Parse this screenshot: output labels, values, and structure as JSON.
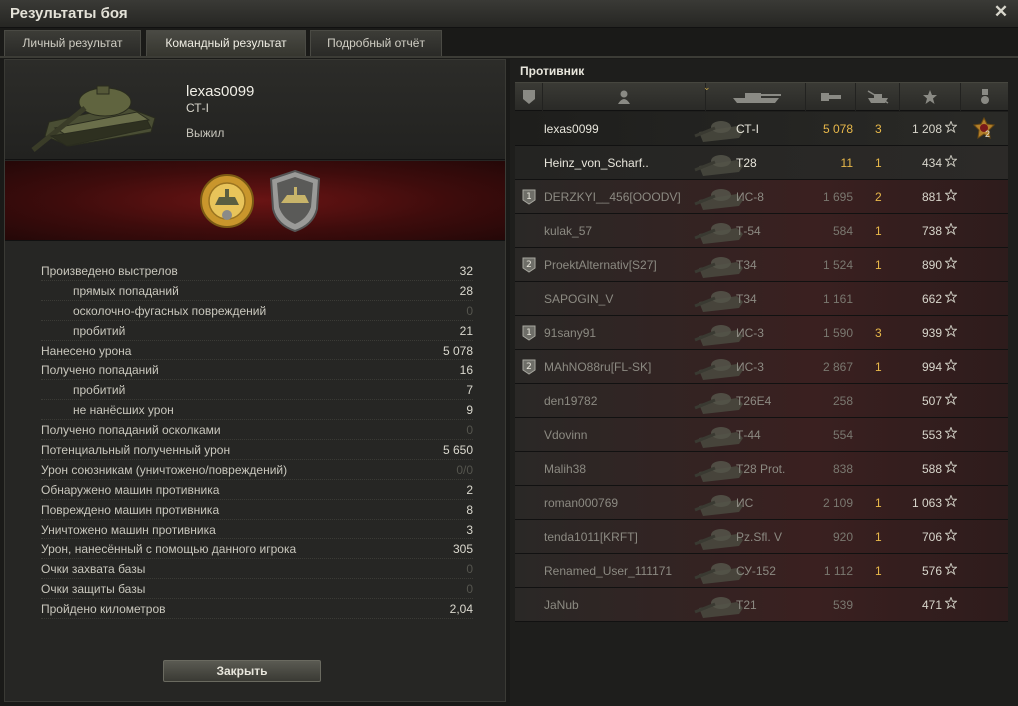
{
  "window": {
    "title": "Результаты боя"
  },
  "tabs": [
    {
      "label": "Личный результат",
      "active": false
    },
    {
      "label": "Командный результат",
      "active": true
    },
    {
      "label": "Подробный отчёт",
      "active": false
    }
  ],
  "player": {
    "name": "lexas0099",
    "tank": "СТ-I",
    "status": "Выжил"
  },
  "stats": [
    {
      "label": "Произведено выстрелов",
      "value": "32",
      "sub": false,
      "dim": false
    },
    {
      "label": "прямых попаданий",
      "value": "28",
      "sub": true,
      "dim": false
    },
    {
      "label": "осколочно-фугасных повреждений",
      "value": "0",
      "sub": true,
      "dim": true
    },
    {
      "label": "пробитий",
      "value": "21",
      "sub": true,
      "dim": false
    },
    {
      "label": "Нанесено урона",
      "value": "5 078",
      "sub": false,
      "dim": false
    },
    {
      "label": "Получено попаданий",
      "value": "16",
      "sub": false,
      "dim": false
    },
    {
      "label": "пробитий",
      "value": "7",
      "sub": true,
      "dim": false
    },
    {
      "label": "не нанёсших урон",
      "value": "9",
      "sub": true,
      "dim": false
    },
    {
      "label": "Получено попаданий осколками",
      "value": "0",
      "sub": false,
      "dim": true
    },
    {
      "label": "Потенциальный полученный урон",
      "value": "5 650",
      "sub": false,
      "dim": false
    },
    {
      "label": "Урон союзникам (уничтожено/повреждений)",
      "value": "0/0",
      "sub": false,
      "dim": true
    },
    {
      "label": "Обнаружено машин противника",
      "value": "2",
      "sub": false,
      "dim": false
    },
    {
      "label": "Повреждено машин противника",
      "value": "8",
      "sub": false,
      "dim": false
    },
    {
      "label": "Уничтожено машин противника",
      "value": "3",
      "sub": false,
      "dim": false
    },
    {
      "label": "Урон, нанесённый с помощью данного игрока",
      "value": "305",
      "sub": false,
      "dim": false
    },
    {
      "label": "Очки захвата базы",
      "value": "0",
      "sub": false,
      "dim": true
    },
    {
      "label": "Очки защиты базы",
      "value": "0",
      "sub": false,
      "dim": true
    },
    {
      "label": "Пройдено километров",
      "value": "2,04",
      "sub": false,
      "dim": false
    }
  ],
  "close_button": "Закрыть",
  "team": {
    "label": "Противник",
    "rows": [
      {
        "name": "lexas0099",
        "vehicle": "СТ-I",
        "damage": "5 078",
        "kills": "3",
        "xp": "1 208",
        "state": "self",
        "tier": "",
        "rank_count": "2"
      },
      {
        "name": "Heinz_von_Scharf..",
        "vehicle": "T28",
        "damage": "11",
        "kills": "1",
        "xp": "434",
        "state": "alive",
        "tier": ""
      },
      {
        "name": "DERZKYI__456[OOODV]",
        "vehicle": "ИС-8",
        "damage": "1 695",
        "kills": "2",
        "xp": "881",
        "state": "dead",
        "tier": "1"
      },
      {
        "name": "kulak_57",
        "vehicle": "Т-54",
        "damage": "584",
        "kills": "1",
        "xp": "738",
        "state": "dead",
        "tier": ""
      },
      {
        "name": "ProektAlternativ[S27]",
        "vehicle": "Т34",
        "damage": "1 524",
        "kills": "1",
        "xp": "890",
        "state": "dead",
        "tier": "2"
      },
      {
        "name": "SAPOGIN_V",
        "vehicle": "Т34",
        "damage": "1 161",
        "kills": "",
        "xp": "662",
        "state": "dead",
        "tier": ""
      },
      {
        "name": "91sany91",
        "vehicle": "ИС-3",
        "damage": "1 590",
        "kills": "3",
        "xp": "939",
        "state": "dead",
        "tier": "1"
      },
      {
        "name": "MAhNO88ru[FL-SK]",
        "vehicle": "ИС-3",
        "damage": "2 867",
        "kills": "1",
        "xp": "994",
        "state": "dead",
        "tier": "2"
      },
      {
        "name": "den19782",
        "vehicle": "T26E4",
        "damage": "258",
        "kills": "",
        "xp": "507",
        "state": "dead",
        "tier": ""
      },
      {
        "name": "Vdovinn",
        "vehicle": "Т-44",
        "damage": "554",
        "kills": "",
        "xp": "553",
        "state": "dead",
        "tier": ""
      },
      {
        "name": "Malih38",
        "vehicle": "T28 Prot.",
        "damage": "838",
        "kills": "",
        "xp": "588",
        "state": "dead",
        "tier": ""
      },
      {
        "name": "roman000769",
        "vehicle": "ИС",
        "damage": "2 109",
        "kills": "1",
        "xp": "1 063",
        "state": "dead",
        "tier": ""
      },
      {
        "name": "tenda1011[KRFT]",
        "vehicle": "Pz.Sfl. V",
        "damage": "920",
        "kills": "1",
        "xp": "706",
        "state": "dead",
        "tier": ""
      },
      {
        "name": "Renamed_User_111171",
        "vehicle": "СУ-152",
        "damage": "1 112",
        "kills": "1",
        "xp": "576",
        "state": "dead",
        "tier": ""
      },
      {
        "name": "JaNub",
        "vehicle": "T21",
        "damage": "539",
        "kills": "",
        "xp": "471",
        "state": "dead",
        "tier": ""
      }
    ]
  },
  "colors": {
    "accent_gold": "#e8b84a",
    "dead_row": "#3a2020",
    "medal_band": "#6a1414"
  }
}
